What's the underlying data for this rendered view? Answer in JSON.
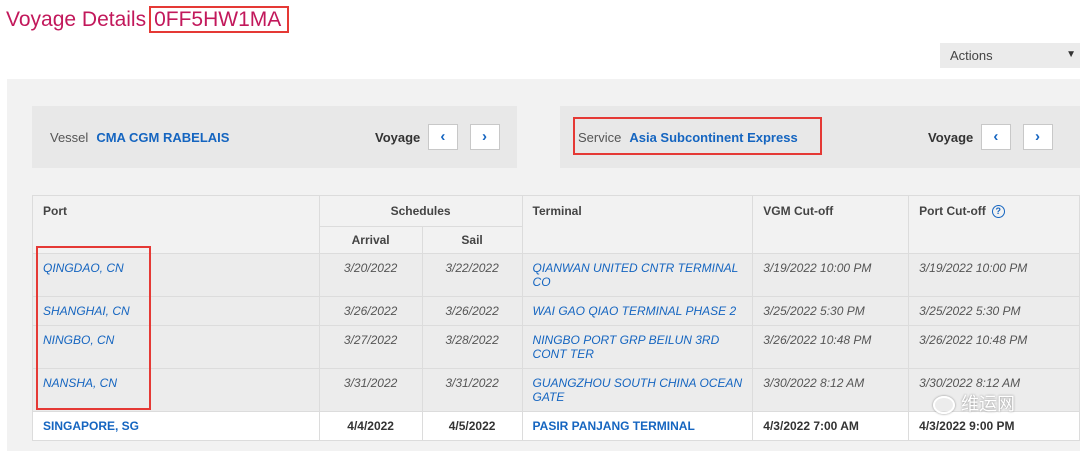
{
  "header": {
    "title": "Voyage Details",
    "voyage_code": "0FF5HW1MA",
    "actions_label": "Actions"
  },
  "vessel_box": {
    "label": "Vessel",
    "value": "CMA CGM RABELAIS",
    "voyage_label": "Voyage"
  },
  "service_box": {
    "label": "Service",
    "value": "Asia Subcontinent Express",
    "voyage_label": "Voyage"
  },
  "nav": {
    "prev": "‹",
    "next": "›"
  },
  "table": {
    "headers": {
      "port": "Port",
      "schedules": "Schedules",
      "arrival": "Arrival",
      "sail": "Sail",
      "terminal": "Terminal",
      "vgm": "VGM Cut-off",
      "port_cutoff": "Port Cut-off",
      "help": "?"
    },
    "rows": [
      {
        "port": "QINGDAO, CN",
        "arrival": "3/20/2022",
        "sail": "3/22/2022",
        "terminal": "QIANWAN UNITED CNTR TERMINAL CO",
        "vgm": "3/19/2022 10:00 PM",
        "port_cutoff": "3/19/2022 10:00 PM"
      },
      {
        "port": "SHANGHAI, CN",
        "arrival": "3/26/2022",
        "sail": "3/26/2022",
        "terminal": "WAI GAO QIAO TERMINAL PHASE 2",
        "vgm": "3/25/2022 5:30 PM",
        "port_cutoff": "3/25/2022 5:30 PM"
      },
      {
        "port": "NINGBO, CN",
        "arrival": "3/27/2022",
        "sail": "3/28/2022",
        "terminal": "NINGBO PORT GRP BEILUN 3RD CONT TER",
        "vgm": "3/26/2022 10:48 PM",
        "port_cutoff": "3/26/2022 10:48 PM"
      },
      {
        "port": "NANSHA, CN",
        "arrival": "3/31/2022",
        "sail": "3/31/2022",
        "terminal": "GUANGZHOU SOUTH CHINA OCEAN GATE",
        "vgm": "3/30/2022 8:12 AM",
        "port_cutoff": "3/30/2022 8:12 AM"
      },
      {
        "port": "SINGAPORE, SG",
        "arrival": "4/4/2022",
        "sail": "4/5/2022",
        "terminal": "PASIR PANJANG TERMINAL",
        "vgm": "4/3/2022 7:00 AM",
        "port_cutoff": "4/3/2022 9:00 PM"
      }
    ]
  },
  "watermark": {
    "text": "维运网",
    "icon": "wechat-icon"
  },
  "colors": {
    "title": "#c2185b",
    "link": "#1565c0",
    "highlight": "#e53935",
    "panel": "#f2f2f2"
  }
}
